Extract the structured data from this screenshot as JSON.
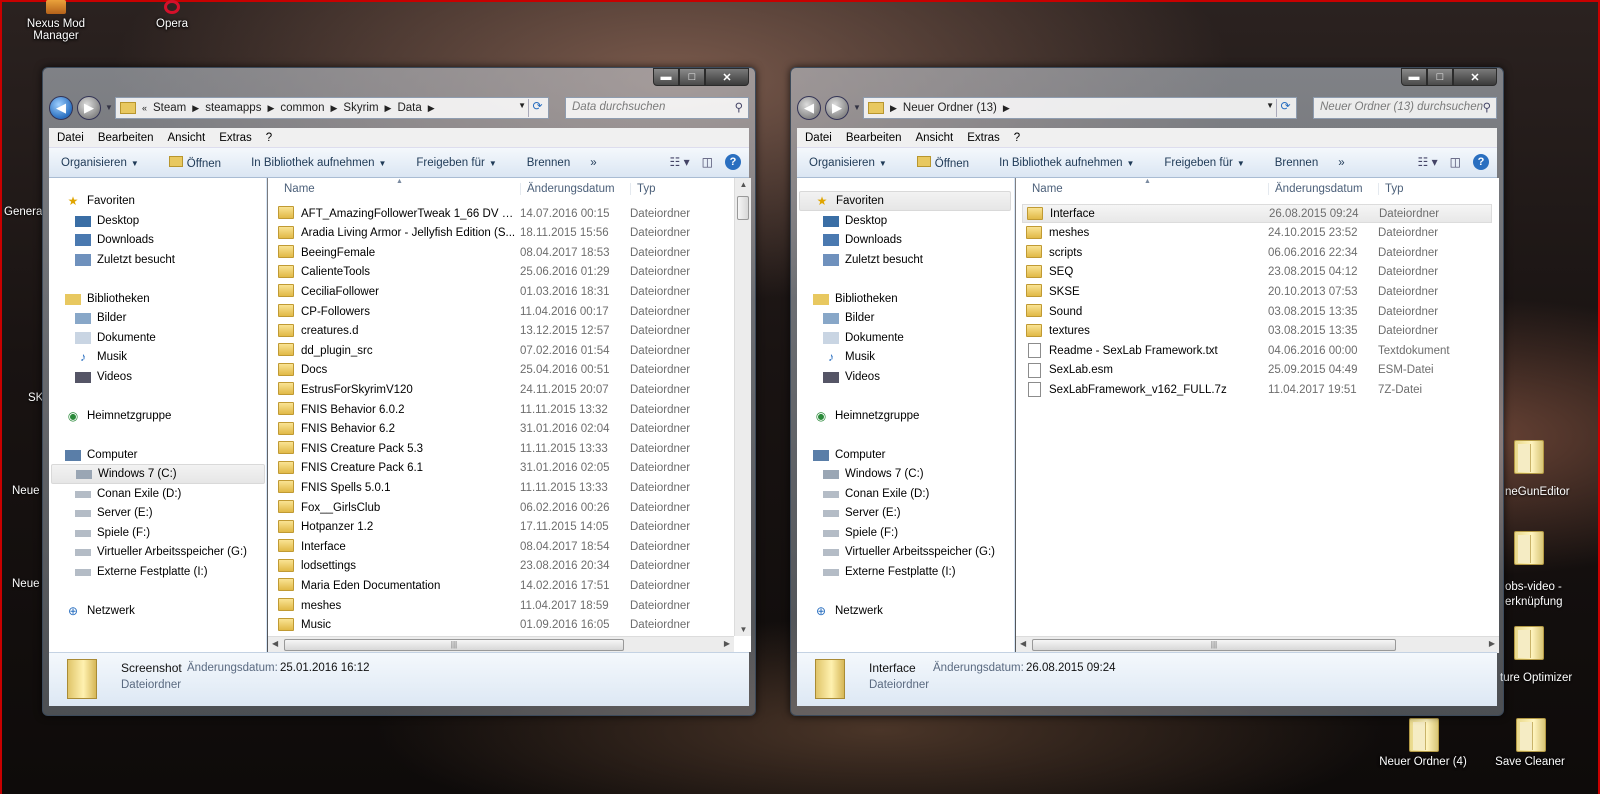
{
  "desktop": {
    "icons": [
      {
        "label": "Nexus Mod Manager"
      },
      {
        "label": "Opera"
      },
      {
        "label": "Neuer Ordner (4)"
      },
      {
        "label": "Save Cleaner"
      }
    ],
    "partial_left": [
      "Genera",
      "SK",
      "Neue",
      "Neue"
    ],
    "partial_right": [
      "neGunEditor",
      "obs-video -",
      "erknüpfung",
      "ture Optimizer"
    ]
  },
  "win1": {
    "caption": {
      "min": "▬",
      "max": "□",
      "close": "✕"
    },
    "address": [
      "Steam",
      "steamapps",
      "common",
      "Skyrim",
      "Data"
    ],
    "search_placeholder": "Data durchsuchen",
    "menu": [
      "Datei",
      "Bearbeiten",
      "Ansicht",
      "Extras",
      "?"
    ],
    "toolbar": [
      "Organisieren",
      "Öffnen",
      "In Bibliothek aufnehmen",
      "Freigeben für",
      "Brennen",
      "»"
    ],
    "nav": {
      "favorites": "Favoriten",
      "desktop": "Desktop",
      "downloads": "Downloads",
      "recent": "Zuletzt besucht",
      "libraries": "Bibliotheken",
      "pictures": "Bilder",
      "documents": "Dokumente",
      "music": "Musik",
      "videos": "Videos",
      "homegroup": "Heimnetzgruppe",
      "computer": "Computer",
      "drives": [
        "Windows 7 (C:)",
        "Conan Exile (D:)",
        "Server (E:)",
        "Spiele (F:)",
        "Virtueller Arbeitsspeicher (G:)",
        "Externe Festplatte (I:)"
      ],
      "network": "Netzwerk"
    },
    "columns": {
      "name": "Name",
      "date": "Änderungsdatum",
      "type": "Typ"
    },
    "files": [
      {
        "name": "AFT_AmazingFollowerTweak 1_66 DV FE i...",
        "date": "14.07.2016 00:15",
        "type": "Dateiordner"
      },
      {
        "name": "Aradia Living Armor - Jellyfish Edition (S...",
        "date": "18.11.2015 15:56",
        "type": "Dateiordner"
      },
      {
        "name": "BeeingFemale",
        "date": "08.04.2017 18:53",
        "type": "Dateiordner"
      },
      {
        "name": "CalienteTools",
        "date": "25.06.2016 01:29",
        "type": "Dateiordner"
      },
      {
        "name": "CeciliaFollower",
        "date": "01.03.2016 18:31",
        "type": "Dateiordner"
      },
      {
        "name": "CP-Followers",
        "date": "11.04.2016 00:17",
        "type": "Dateiordner"
      },
      {
        "name": "creatures.d",
        "date": "13.12.2015 12:57",
        "type": "Dateiordner"
      },
      {
        "name": "dd_plugin_src",
        "date": "07.02.2016 01:54",
        "type": "Dateiordner"
      },
      {
        "name": "Docs",
        "date": "25.04.2016 00:51",
        "type": "Dateiordner"
      },
      {
        "name": "EstrusForSkyrimV120",
        "date": "24.11.2015 20:07",
        "type": "Dateiordner"
      },
      {
        "name": "FNIS Behavior 6.0.2",
        "date": "11.11.2015 13:32",
        "type": "Dateiordner"
      },
      {
        "name": "FNIS Behavior 6.2",
        "date": "31.01.2016 02:04",
        "type": "Dateiordner"
      },
      {
        "name": "FNIS Creature Pack 5.3",
        "date": "11.11.2015 13:33",
        "type": "Dateiordner"
      },
      {
        "name": "FNIS Creature Pack 6.1",
        "date": "31.01.2016 02:05",
        "type": "Dateiordner"
      },
      {
        "name": "FNIS Spells 5.0.1",
        "date": "11.11.2015 13:33",
        "type": "Dateiordner"
      },
      {
        "name": "Fox__GirlsClub",
        "date": "06.02.2016 00:26",
        "type": "Dateiordner"
      },
      {
        "name": "Hotpanzer 1.2",
        "date": "17.11.2015 14:05",
        "type": "Dateiordner"
      },
      {
        "name": "Interface",
        "date": "08.04.2017 18:54",
        "type": "Dateiordner"
      },
      {
        "name": "lodsettings",
        "date": "23.08.2016 20:34",
        "type": "Dateiordner"
      },
      {
        "name": "Maria Eden Documentation",
        "date": "14.02.2016 17:51",
        "type": "Dateiordner"
      },
      {
        "name": "meshes",
        "date": "11.04.2017 18:59",
        "type": "Dateiordner"
      },
      {
        "name": "Music",
        "date": "01.09.2016 16:05",
        "type": "Dateiordner"
      }
    ],
    "details": {
      "name": "Screenshot",
      "date_label": "Änderungsdatum:",
      "date": "25.01.2016 16:12",
      "type": "Dateiordner"
    }
  },
  "win2": {
    "caption": {
      "min": "▬",
      "max": "□",
      "close": "✕"
    },
    "address": [
      "Neuer Ordner (13)"
    ],
    "search_placeholder": "Neuer Ordner (13) durchsuchen",
    "menu": [
      "Datei",
      "Bearbeiten",
      "Ansicht",
      "Extras",
      "?"
    ],
    "toolbar": [
      "Organisieren",
      "Öffnen",
      "In Bibliothek aufnehmen",
      "Freigeben für",
      "Brennen",
      "»"
    ],
    "nav": {
      "favorites": "Favoriten",
      "desktop": "Desktop",
      "downloads": "Downloads",
      "recent": "Zuletzt besucht",
      "libraries": "Bibliotheken",
      "pictures": "Bilder",
      "documents": "Dokumente",
      "music": "Musik",
      "videos": "Videos",
      "homegroup": "Heimnetzgruppe",
      "computer": "Computer",
      "drives": [
        "Windows 7 (C:)",
        "Conan Exile (D:)",
        "Server (E:)",
        "Spiele (F:)",
        "Virtueller Arbeitsspeicher (G:)",
        "Externe Festplatte (I:)"
      ],
      "network": "Netzwerk"
    },
    "columns": {
      "name": "Name",
      "date": "Änderungsdatum",
      "type": "Typ"
    },
    "files": [
      {
        "name": "Interface",
        "date": "26.08.2015 09:24",
        "type": "Dateiordner",
        "kind": "folder"
      },
      {
        "name": "meshes",
        "date": "24.10.2015 23:52",
        "type": "Dateiordner",
        "kind": "folder"
      },
      {
        "name": "scripts",
        "date": "06.06.2016 22:34",
        "type": "Dateiordner",
        "kind": "folder"
      },
      {
        "name": "SEQ",
        "date": "23.08.2015 04:12",
        "type": "Dateiordner",
        "kind": "folder"
      },
      {
        "name": "SKSE",
        "date": "20.10.2013 07:53",
        "type": "Dateiordner",
        "kind": "folder"
      },
      {
        "name": "Sound",
        "date": "03.08.2015 13:35",
        "type": "Dateiordner",
        "kind": "folder"
      },
      {
        "name": "textures",
        "date": "03.08.2015 13:35",
        "type": "Dateiordner",
        "kind": "folder"
      },
      {
        "name": "Readme - SexLab Framework.txt",
        "date": "04.06.2016 00:00",
        "type": "Textdokument",
        "kind": "file"
      },
      {
        "name": "SexLab.esm",
        "date": "25.09.2015 04:49",
        "type": "ESM-Datei",
        "kind": "file"
      },
      {
        "name": "SexLabFramework_v162_FULL.7z",
        "date": "11.04.2017 19:51",
        "type": "7Z-Datei",
        "kind": "file"
      }
    ],
    "details": {
      "name": "Interface",
      "date_label": "Änderungsdatum:",
      "date": "26.08.2015 09:24",
      "type": "Dateiordner"
    }
  }
}
